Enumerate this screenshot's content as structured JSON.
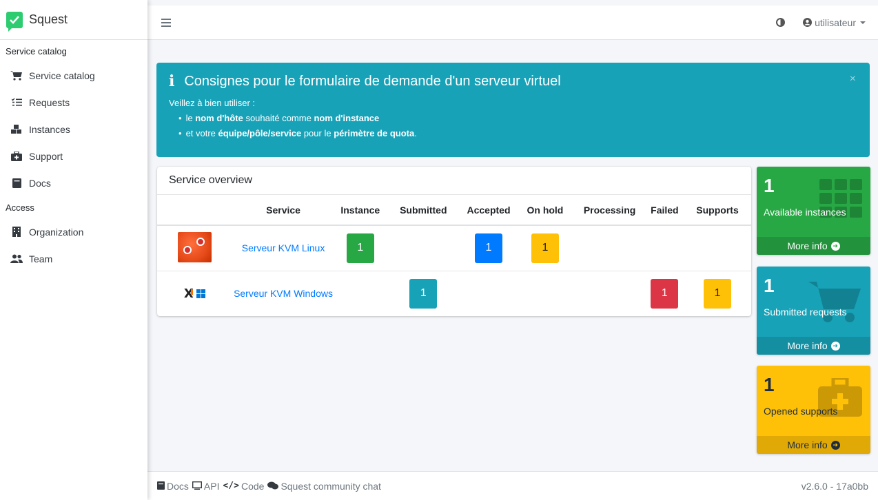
{
  "brand": {
    "name": "Squest"
  },
  "sidebar": {
    "sections": [
      {
        "header": "Service catalog"
      },
      {
        "header": "Access"
      }
    ],
    "items": [
      {
        "label": "Service catalog",
        "icon": "cart-icon"
      },
      {
        "label": "Requests",
        "icon": "list-check-icon"
      },
      {
        "label": "Instances",
        "icon": "cubes-icon"
      },
      {
        "label": "Support",
        "icon": "medkit-icon"
      },
      {
        "label": "Docs",
        "icon": "book-icon"
      },
      {
        "label": "Organization",
        "icon": "building-icon"
      },
      {
        "label": "Team",
        "icon": "users-icon"
      }
    ]
  },
  "topbar": {
    "user": "utilisateur"
  },
  "alert": {
    "title": "Consignes pour le formulaire de demande d'un serveur virtuel",
    "intro": "Veillez à bien utiliser :",
    "line1": {
      "a": "le ",
      "b": "nom d'hôte",
      "c": " souhaité comme ",
      "d": "nom d'instance"
    },
    "line2": {
      "a": "et votre ",
      "b": "équipe/pôle/service",
      "c": " pour le ",
      "d": "périmètre de quota",
      "e": "."
    },
    "close": "×"
  },
  "overview": {
    "title": "Service overview",
    "columns": [
      "",
      "Service",
      "Instance",
      "Submitted",
      "Accepted",
      "On hold",
      "Processing",
      "Failed",
      "Supports"
    ],
    "rows": [
      {
        "service": "Serveur KVM Linux",
        "instance": "1",
        "submitted": "",
        "accepted": "1",
        "on_hold": "1",
        "processing": "",
        "failed": "",
        "supports": ""
      },
      {
        "service": "Serveur KVM Windows",
        "instance": "",
        "submitted": "1",
        "accepted": "",
        "on_hold": "",
        "processing": "",
        "failed": "1",
        "supports": "1"
      }
    ]
  },
  "boxes": [
    {
      "number": "1",
      "label": "Available instances",
      "more": "More info",
      "color": "#28a745"
    },
    {
      "number": "1",
      "label": "Submitted requests",
      "more": "More info",
      "color": "#17a2b8"
    },
    {
      "number": "1",
      "label": "Opened supports",
      "more": "More info",
      "color": "#ffc107"
    }
  ],
  "footer": {
    "docs": "Docs",
    "api": "API",
    "code": "Code",
    "chat": "Squest community chat",
    "version": "v2.6.0 - 17a0bb"
  }
}
